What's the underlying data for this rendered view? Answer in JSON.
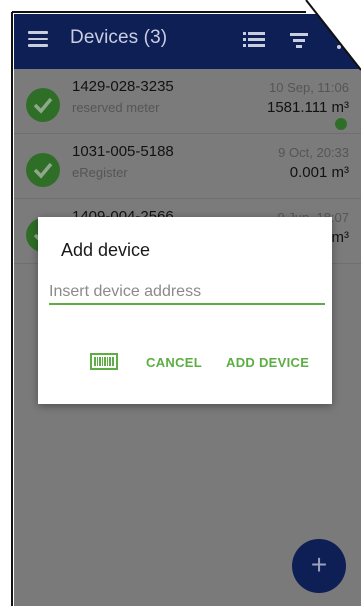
{
  "app_bar": {
    "title": "Devices (3)",
    "menu_icon": "hamburger-menu-icon",
    "list_view_icon": "list-view-icon",
    "filter_icon": "filter-icon",
    "more_icon": "more-vert-icon",
    "background": "#0e1f56"
  },
  "devices": [
    {
      "address": "1429-028-3235",
      "description": "reserved meter",
      "timestamp": "10 Sep, 11:06",
      "value": "1581.111 m³",
      "status_icon": "check-circle-icon",
      "extra_icon": "globe-icon"
    },
    {
      "address": "1031-005-5188",
      "description": "eRegister",
      "timestamp": "9 Oct, 20:33",
      "value": "0.001 m³",
      "status_icon": "check-circle-icon"
    },
    {
      "address": "1409-004-2566",
      "description": "",
      "timestamp": "9 Jun, 18:07",
      "value": "m³",
      "status_icon": "check-circle-icon"
    }
  ],
  "fab": {
    "label": "+",
    "icon": "add-icon"
  },
  "dialog": {
    "title": "Add device",
    "input_placeholder": "Insert device address",
    "input_value": "",
    "barcode_icon": "barcode-scan-icon",
    "cancel_label": "CANCEL",
    "add_label": "ADD DEVICE",
    "accent": "#5cae44"
  }
}
